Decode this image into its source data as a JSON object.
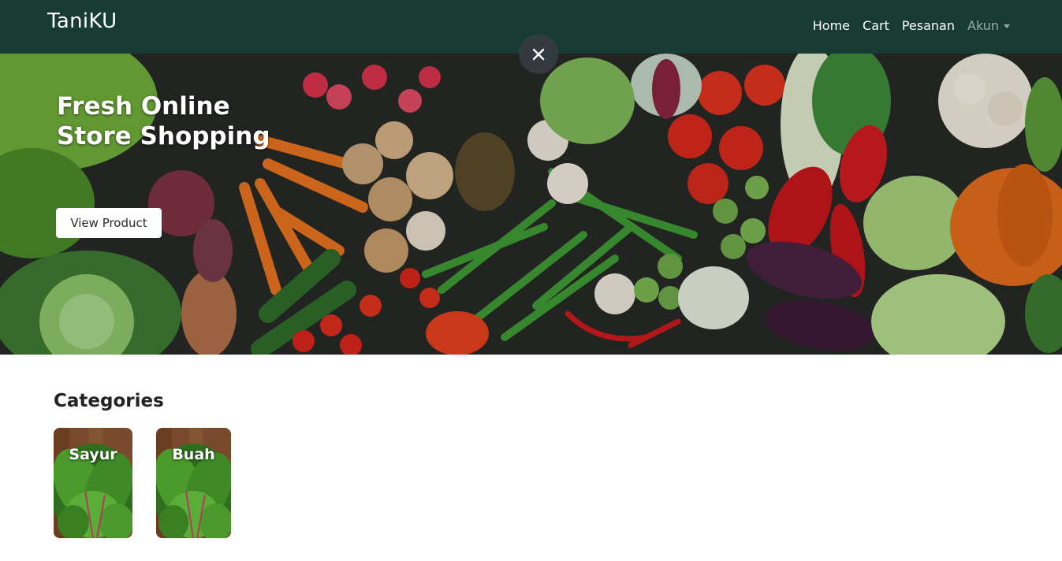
{
  "navbar": {
    "brand": "TaniKU",
    "links": [
      {
        "label": "Home"
      },
      {
        "label": "Cart"
      },
      {
        "label": "Pesanan"
      },
      {
        "label": "Akun"
      }
    ],
    "background": "#183c34"
  },
  "loading": {
    "progress": 0.2
  },
  "hero": {
    "title_line1": "Fresh Online",
    "title_line2": "Store Shopping",
    "button_label": "View Product",
    "image": "vegetables-photo"
  },
  "close_button": {
    "icon": "close-icon"
  },
  "categories": {
    "heading": "Categories",
    "items": [
      {
        "label": "Sayur",
        "image": "leafy-greens-photo"
      },
      {
        "label": "Buah",
        "image": "leafy-greens-photo"
      }
    ]
  }
}
